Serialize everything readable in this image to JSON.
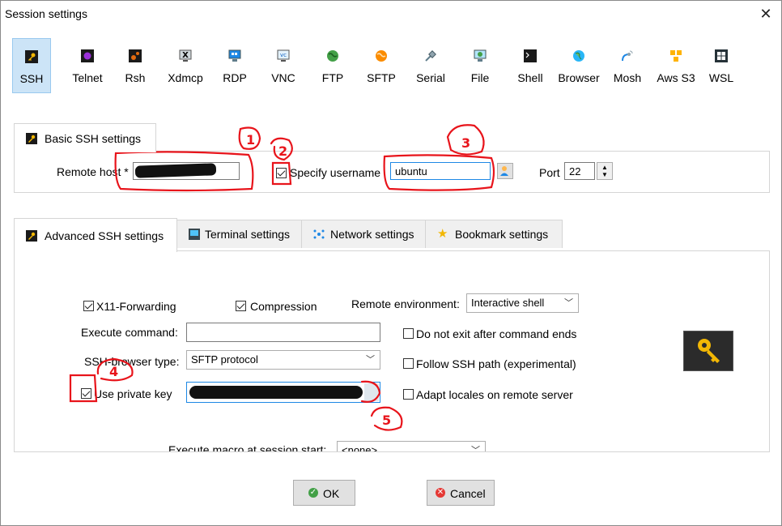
{
  "window": {
    "title": "Session settings"
  },
  "protocols": [
    {
      "label": "SSH",
      "icon": "ssh-key-icon",
      "selected": true
    },
    {
      "label": "Telnet",
      "icon": "telnet-icon"
    },
    {
      "label": "Rsh",
      "icon": "rsh-icon"
    },
    {
      "label": "Xdmcp",
      "icon": "xdmcp-icon"
    },
    {
      "label": "RDP",
      "icon": "rdp-monitor-icon"
    },
    {
      "label": "VNC",
      "icon": "vnc-icon"
    },
    {
      "label": "FTP",
      "icon": "ftp-globe-icon"
    },
    {
      "label": "SFTP",
      "icon": "sftp-icon"
    },
    {
      "label": "Serial",
      "icon": "serial-plug-icon"
    },
    {
      "label": "File",
      "icon": "file-monitor-icon"
    },
    {
      "label": "Shell",
      "icon": "shell-terminal-icon"
    },
    {
      "label": "Browser",
      "icon": "browser-globe-icon"
    },
    {
      "label": "Mosh",
      "icon": "mosh-satellite-icon"
    },
    {
      "label": "Aws S3",
      "icon": "aws-s3-cubes-icon"
    },
    {
      "label": "WSL",
      "icon": "wsl-windows-icon"
    }
  ],
  "basic": {
    "tab_label": "Basic SSH settings",
    "remote_host_label": "Remote host *",
    "remote_host_value": "",
    "specify_username_label": "Specify username",
    "username_value": "ubuntu",
    "port_label": "Port",
    "port_value": "22"
  },
  "advanced_tabs": [
    {
      "label": "Advanced SSH settings",
      "active": true
    },
    {
      "label": "Terminal settings"
    },
    {
      "label": "Network settings"
    },
    {
      "label": "Bookmark settings"
    }
  ],
  "advanced": {
    "x11_label": "X11-Forwarding",
    "compression_label": "Compression",
    "remote_env_label": "Remote environment:",
    "remote_env_value": "Interactive shell",
    "execute_command_label": "Execute command:",
    "execute_command_value": "",
    "do_not_exit_label": "Do not exit after command ends",
    "browser_type_label": "SSH-browser type:",
    "browser_type_value": "SFTP protocol",
    "follow_path_label": "Follow SSH path (experimental)",
    "use_private_key_label": "Use private key",
    "private_key_value": "",
    "adapt_locales_label": "Adapt locales on remote server",
    "macro_label": "Execute macro at session start:",
    "macro_value": "<none>"
  },
  "buttons": {
    "ok": "OK",
    "cancel": "Cancel"
  },
  "annotations": [
    "1",
    "2",
    "3",
    "4",
    "5"
  ],
  "colors": {
    "selected_bg": "#cce4f7",
    "annotation_red": "#e8141b",
    "key_bg": "#2b2b2b",
    "key_gold": "#f2b705"
  }
}
